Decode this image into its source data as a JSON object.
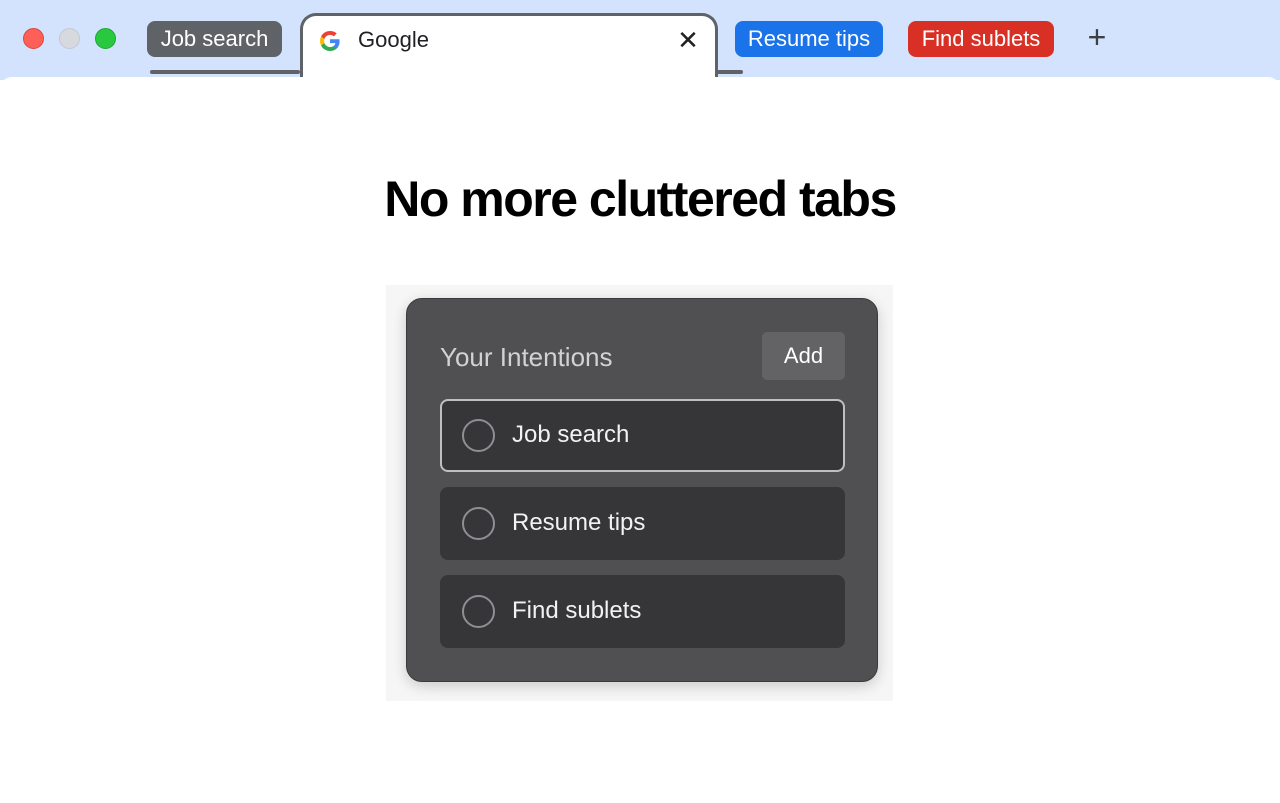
{
  "browser": {
    "tab_groups": [
      {
        "label": "Job search",
        "color": "#5f6368"
      },
      {
        "label": "Resume tips",
        "color": "#1a73e8"
      },
      {
        "label": "Find sublets",
        "color": "#d93025"
      }
    ],
    "active_tab": {
      "title": "Google",
      "favicon": "google-g-icon",
      "close_glyph": "✕"
    },
    "new_tab_glyph": "+"
  },
  "page": {
    "headline": "No more cluttered tabs"
  },
  "intentions_panel": {
    "title": "Your Intentions",
    "add_label": "Add",
    "items": [
      {
        "label": "Job search",
        "selected": true
      },
      {
        "label": "Resume tips",
        "selected": false
      },
      {
        "label": "Find sublets",
        "selected": false
      }
    ]
  }
}
